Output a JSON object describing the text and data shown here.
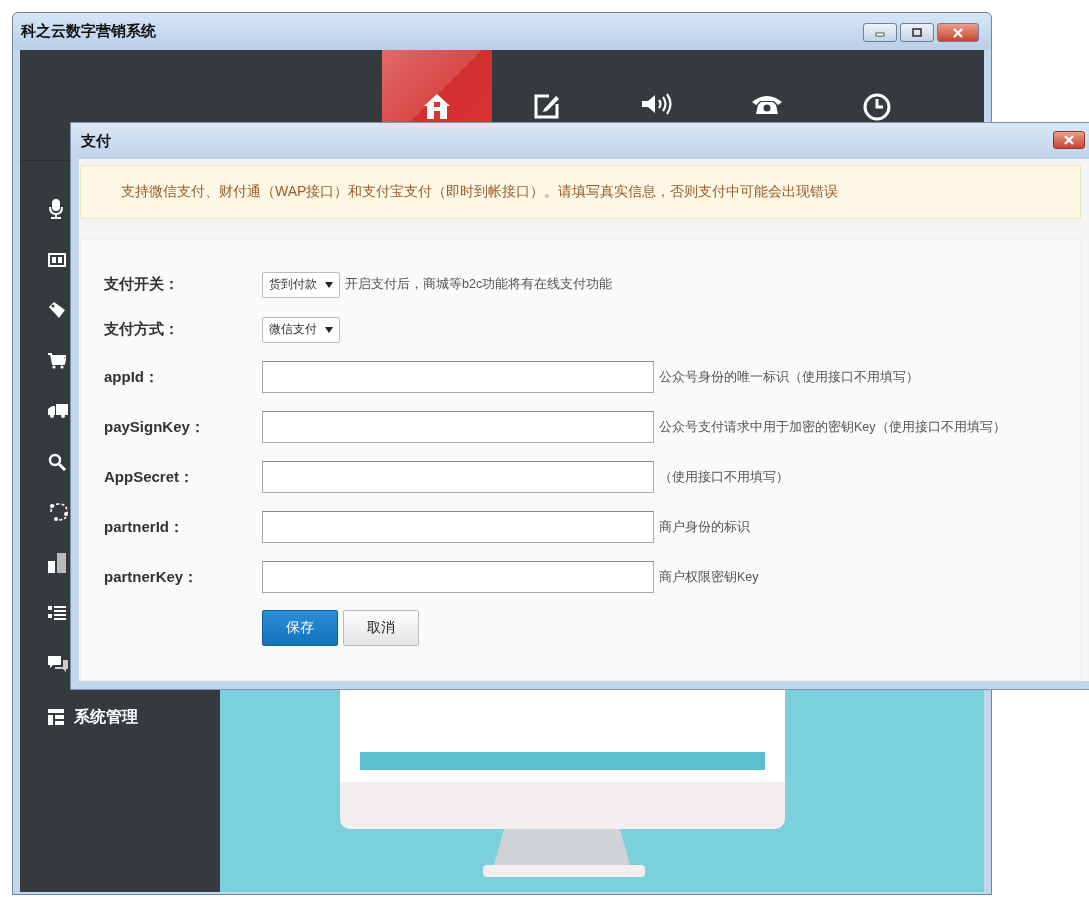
{
  "window": {
    "title": "科之云数字营销系统"
  },
  "nav_tabs": [
    {
      "selected": true
    },
    {
      "selected": false
    },
    {
      "selected": false
    },
    {
      "selected": false
    },
    {
      "selected": false
    }
  ],
  "sidebar": {
    "items": [
      {
        "kind": "icon"
      },
      {
        "kind": "icon"
      },
      {
        "kind": "icon"
      },
      {
        "kind": "icon"
      },
      {
        "kind": "icon"
      },
      {
        "kind": "icon"
      },
      {
        "kind": "icon"
      },
      {
        "kind": "icon"
      },
      {
        "kind": "icon"
      },
      {
        "kind": "icon"
      },
      {
        "kind": "labeled",
        "label": "系统管理"
      }
    ]
  },
  "dialog": {
    "title": "支付",
    "notice": "支持微信支付、财付通（WAP接口）和支付宝支付（即时到帐接口）。请填写真实信息，否则支付中可能会出现错误",
    "fields": [
      {
        "label": "支付开关：",
        "kind": "select",
        "value": "货到付款",
        "hint": "开启支付后，商城等b2c功能将有在线支付功能"
      },
      {
        "label": "支付方式：",
        "kind": "select",
        "value": "微信支付"
      },
      {
        "label": "appId：",
        "kind": "input",
        "hint": "公众号身份的唯一标识（使用接口不用填写）"
      },
      {
        "label": "paySignKey：",
        "kind": "input",
        "hint": "公众号支付请求中用于加密的密钥Key（使用接口不用填写）"
      },
      {
        "label": "AppSecret：",
        "kind": "input",
        "hint": "（使用接口不用填写）"
      },
      {
        "label": "partnerId：",
        "kind": "input",
        "hint": "商户身份的标识"
      },
      {
        "label": "partnerKey：",
        "kind": "input",
        "hint": "商户权限密钥Key"
      }
    ],
    "buttons": [
      {
        "label": "保存",
        "kind": "primary"
      },
      {
        "label": "取消",
        "kind": "default"
      }
    ]
  }
}
